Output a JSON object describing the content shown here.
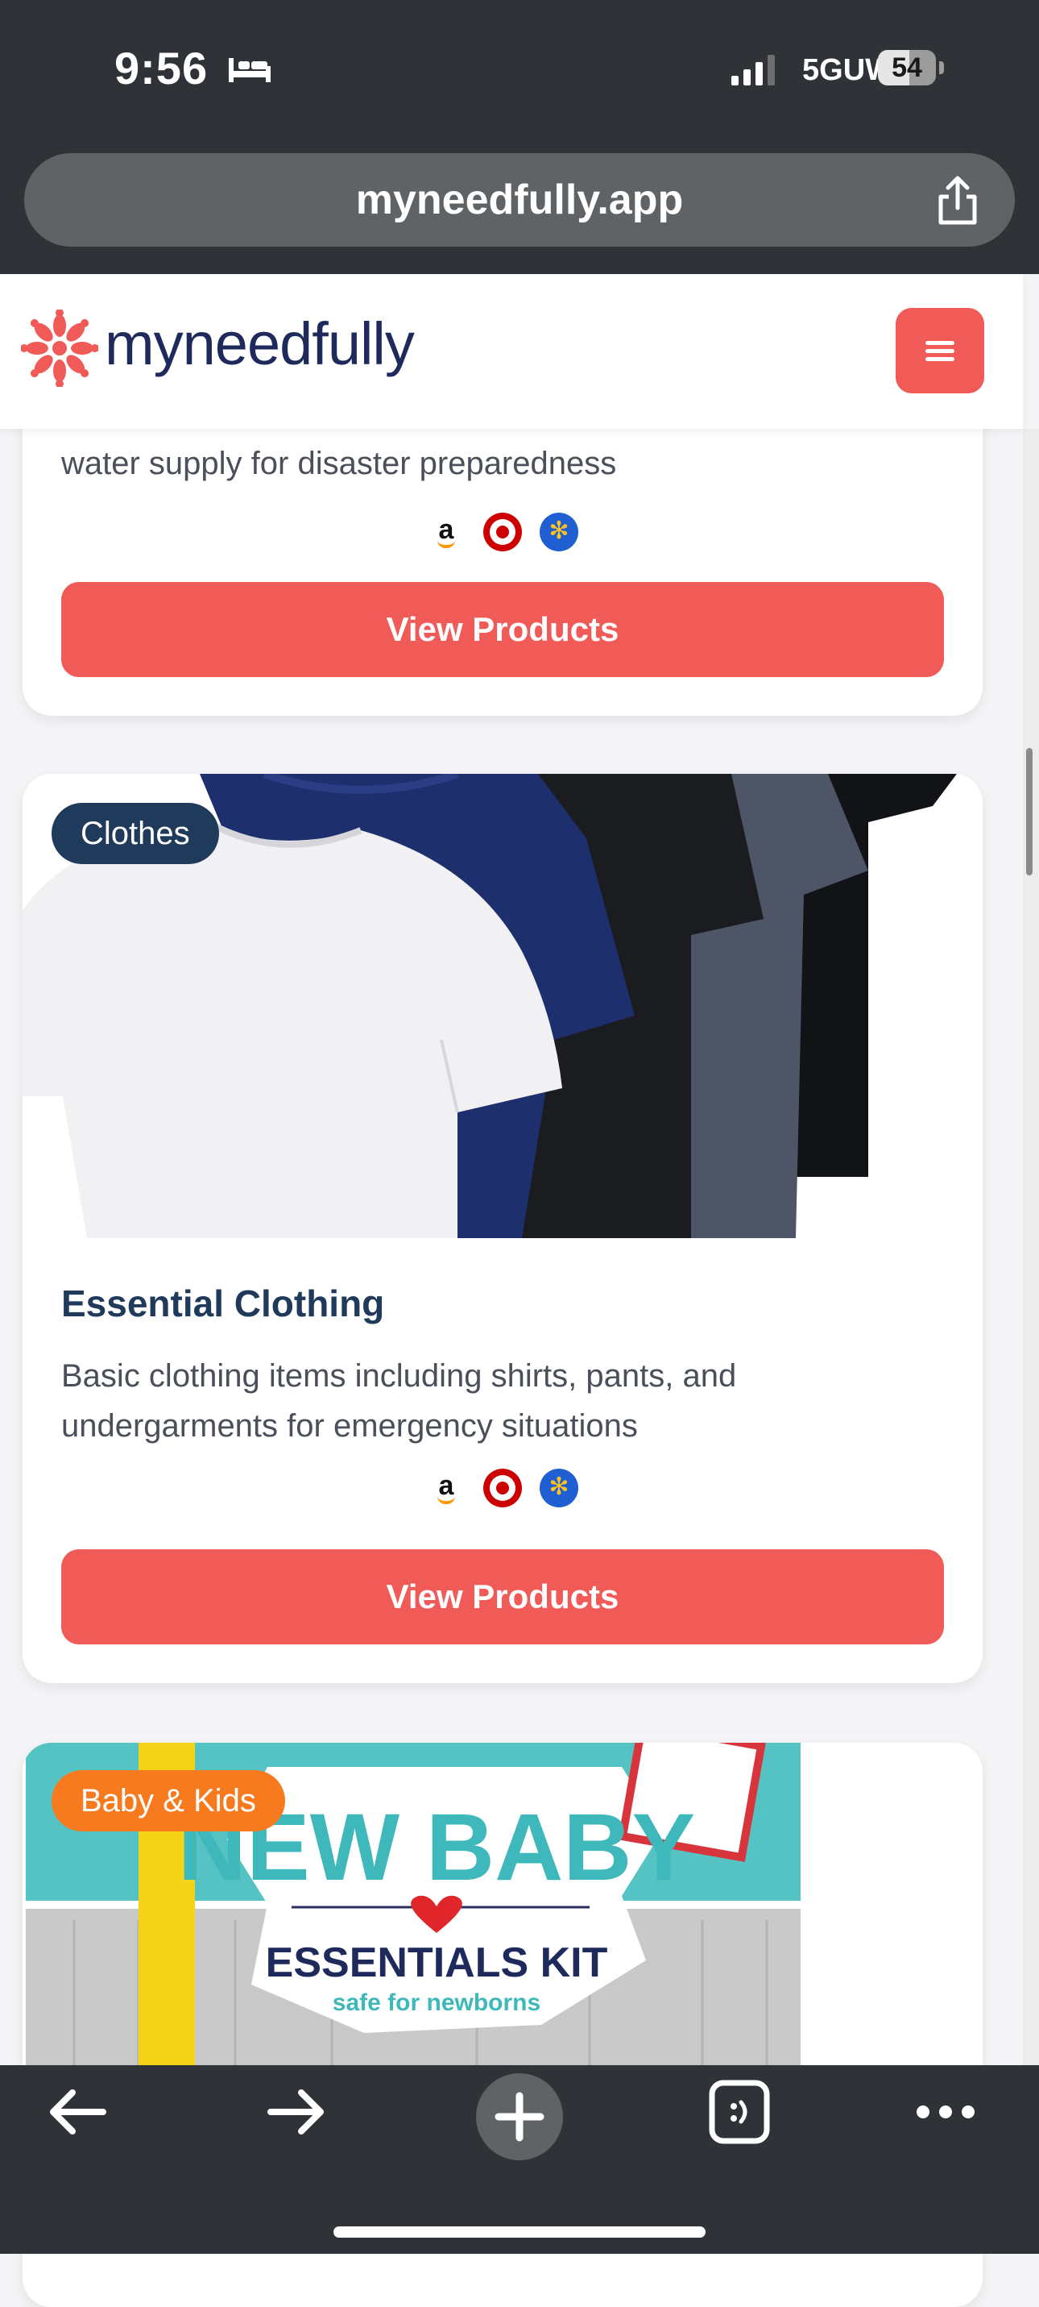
{
  "status_bar": {
    "time": "9:56",
    "network": "5GUW",
    "battery": "54",
    "battery_level": 0.54
  },
  "browser": {
    "url": "myneedfully.app"
  },
  "site": {
    "brand": "myneedfully"
  },
  "cards": [
    {
      "description": "water supply for disaster preparedness",
      "stores": [
        "amazon",
        "target",
        "walmart"
      ],
      "button": "View Products"
    },
    {
      "badge": "Clothes",
      "title": "Essential Clothing",
      "description_lines": [
        "Basic clothing items including shirts, pants, and",
        "undergarments for emergency situations"
      ],
      "stores": [
        "amazon",
        "target",
        "walmart"
      ],
      "button": "View Products",
      "image": "t-shirts-icon"
    },
    {
      "badge": "Baby & Kids",
      "image_text": {
        "headline": "NEW BABY",
        "subhead": "ESSENTIALS KIT",
        "tagline": "safe for newborns"
      },
      "image": "baby-kit-icon"
    }
  ],
  "toolbar": [
    "back-icon",
    "forward-icon",
    "new-tab-icon",
    "tabs-icon",
    "more-icon"
  ],
  "colors": {
    "accent": "#f05a57",
    "navy": "#1f3a5a",
    "badge_dark": "#1f3a5a",
    "badge_orange": "#f77b1e",
    "chrome": "#2f3236"
  }
}
